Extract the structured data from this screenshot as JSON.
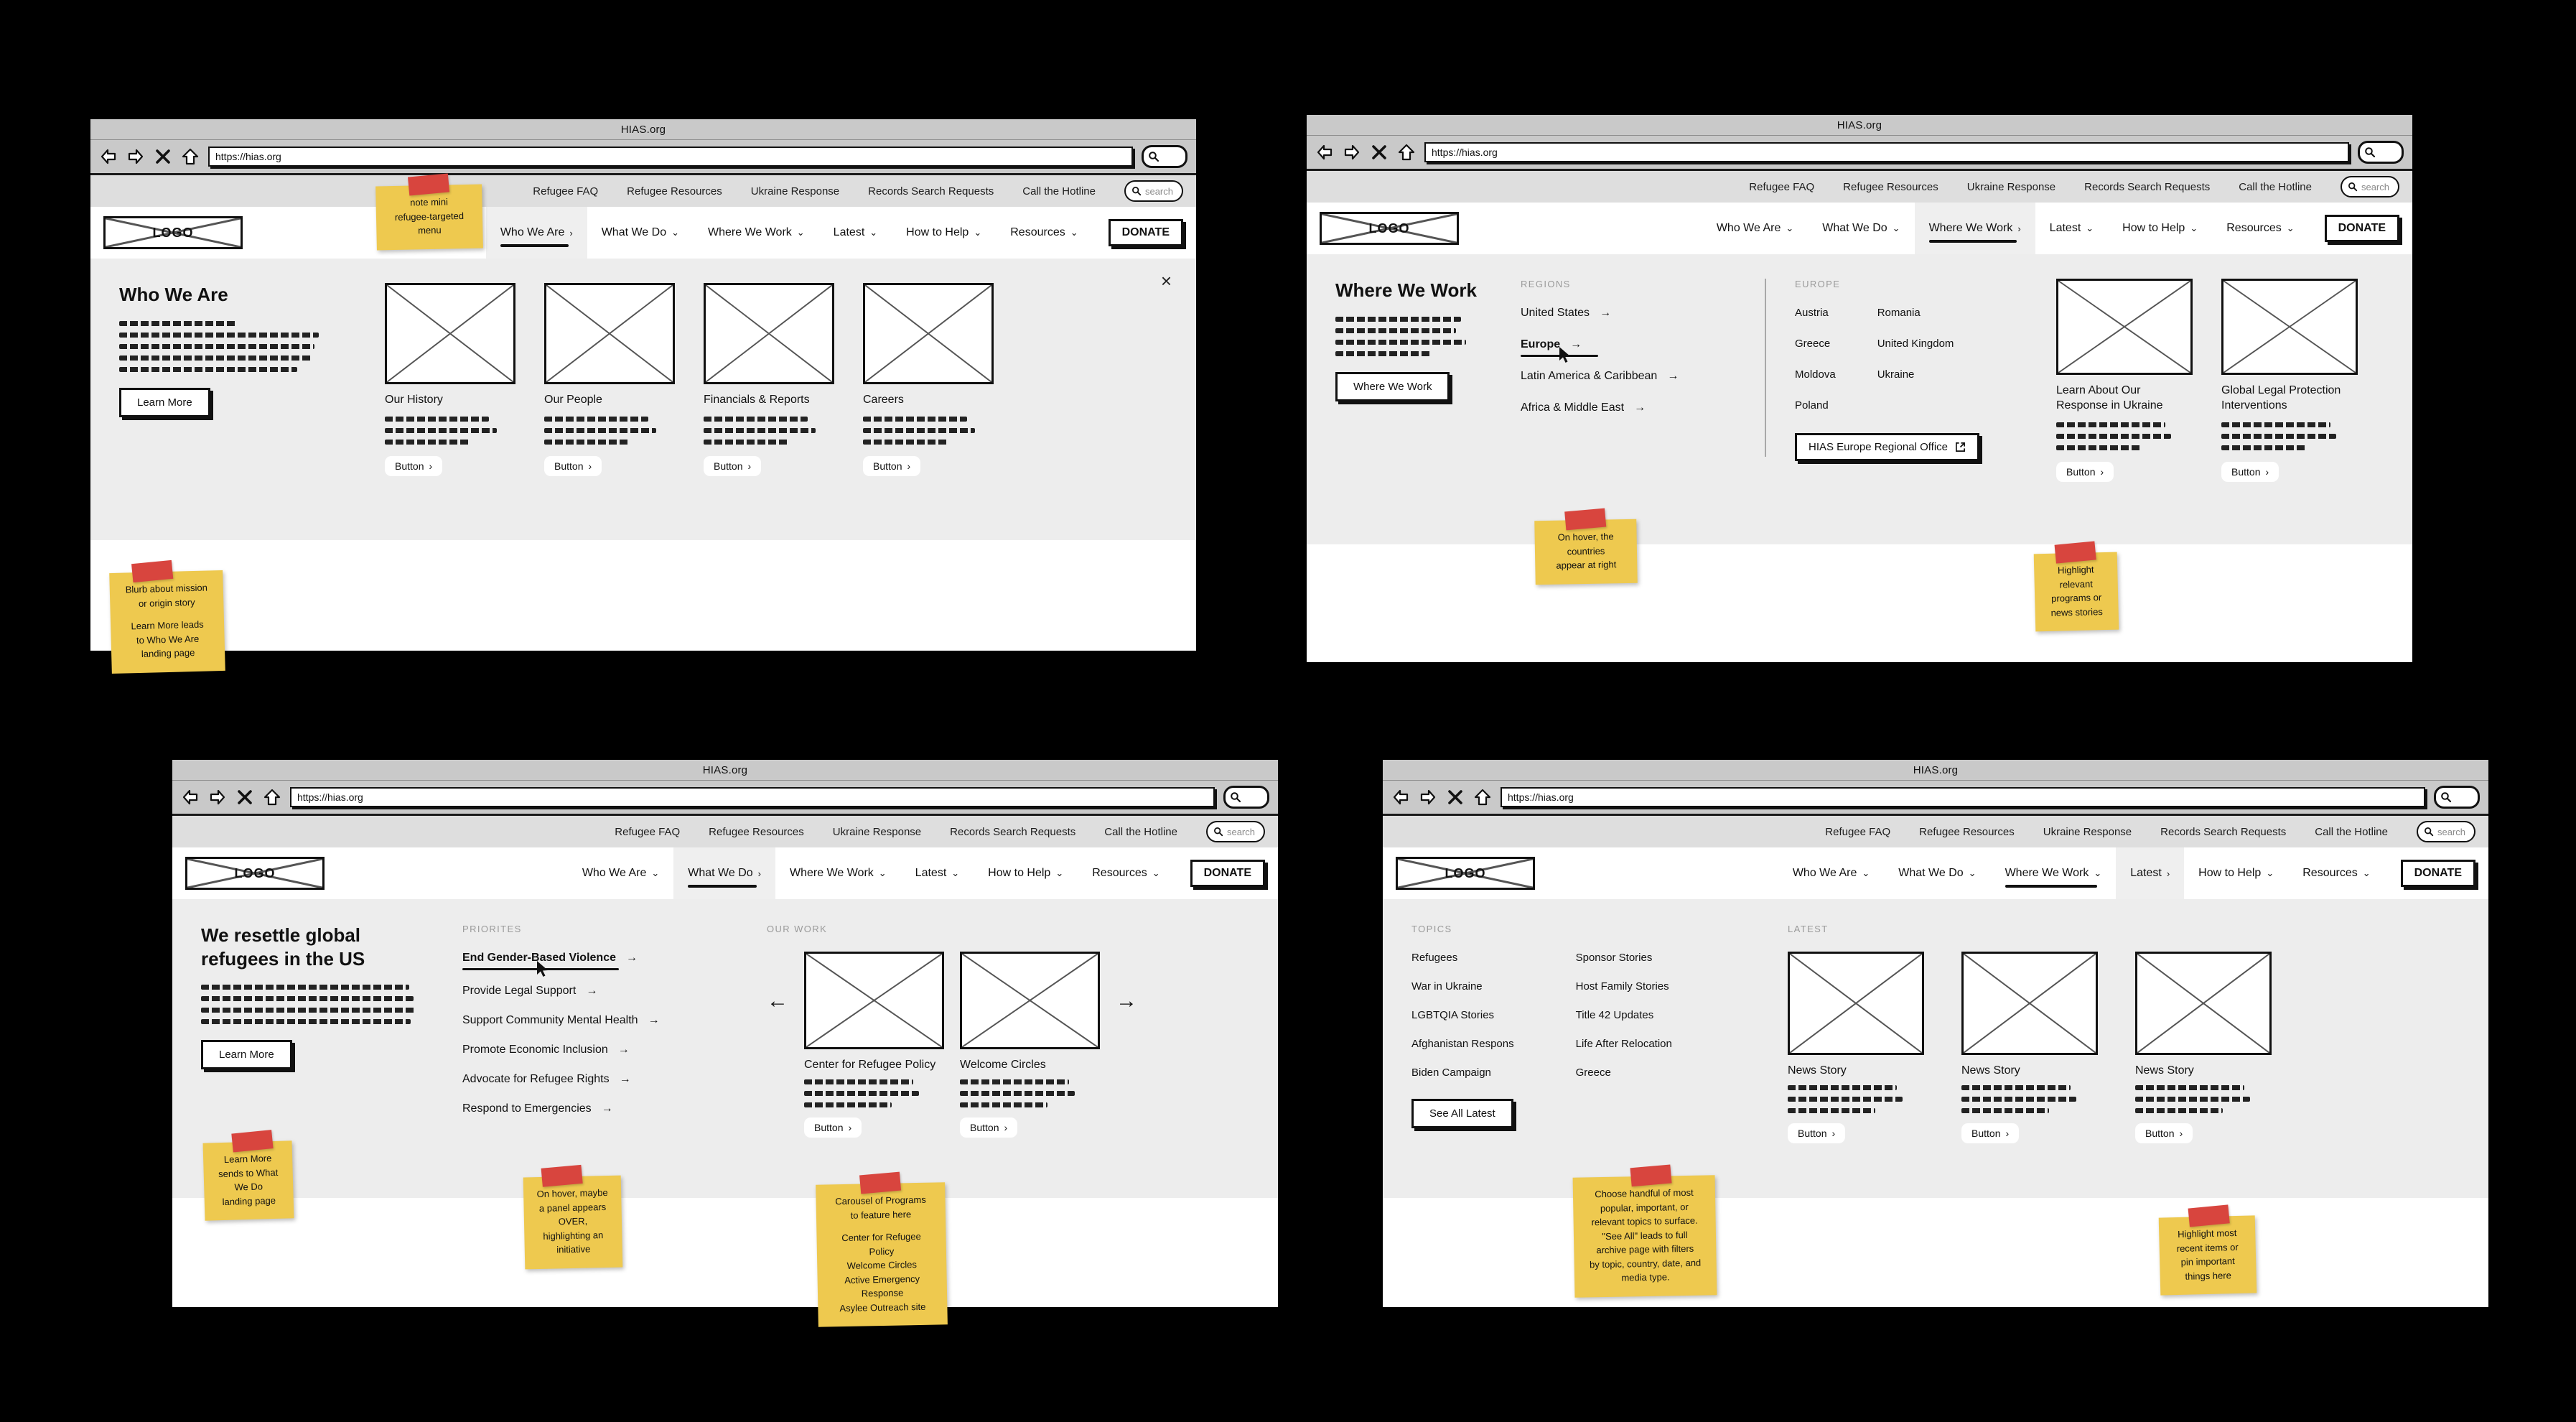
{
  "browser": {
    "title": "HIAS.org",
    "url": "https://hias.org",
    "back_icon": "back-arrow-icon",
    "forward_icon": "forward-arrow-icon",
    "stop_icon": "close-x-icon",
    "home_icon": "home-icon",
    "search_icon": "search-icon"
  },
  "utility_nav": {
    "items": [
      "Refugee FAQ",
      "Refugee Resources",
      "Ukraine Response",
      "Records Search Requests",
      "Call the Hotline"
    ],
    "search_placeholder": "search"
  },
  "brand": {
    "logo_label": "LOGO"
  },
  "main_nav": {
    "items": [
      "Who We Are",
      "What We Do",
      "Where We Work",
      "Latest",
      "How to Help",
      "Resources"
    ],
    "donate_label": "DONATE",
    "chevron_down": "⌄",
    "chevron_right": "›"
  },
  "panel1": {
    "active_tab": "Who We Are",
    "heading": "Who We Are",
    "cta": "Learn More",
    "close_label": "×",
    "cards": [
      {
        "title": "Our History",
        "button": "Button"
      },
      {
        "title": "Our People",
        "button": "Button"
      },
      {
        "title": "Financials & Reports",
        "button": "Button"
      },
      {
        "title": "Careers",
        "button": "Button"
      }
    ],
    "notes": [
      {
        "lines": [
          "note mini",
          "refugee-targeted",
          "menu"
        ]
      },
      {
        "lines": [
          "Blurb about mission",
          "or origin story"
        ],
        "lines2": [
          "Learn More leads",
          "to Who We Are",
          "landing page"
        ]
      }
    ]
  },
  "panel2": {
    "active_tab": "Where We Work",
    "heading": "Where We Work",
    "cta": "Where We Work",
    "regions_label": "REGIONS",
    "regions": [
      "United States",
      "Europe",
      "Latin America & Caribbean",
      "Africa & Middle East"
    ],
    "hovered_region": "Europe",
    "europe_label": "EUROPE",
    "countries_col1": [
      "Austria",
      "Greece",
      "Moldova",
      "Poland"
    ],
    "countries_col2": [
      "Romania",
      "United Kingdom",
      "Ukraine"
    ],
    "office_button": "HIAS Europe Regional Office",
    "office_icon": "external-link-icon",
    "cards": [
      {
        "title": "Learn About Our Response in Ukraine",
        "button": "Button"
      },
      {
        "title": "Global Legal Protection Interventions",
        "button": "Button"
      }
    ],
    "notes": [
      {
        "lines": [
          "On hover, the",
          "countries",
          "appear at right"
        ]
      },
      {
        "lines": [
          "Highlight",
          "relevant",
          "programs or",
          "news stories"
        ]
      }
    ]
  },
  "panel3": {
    "active_tab": "What We Do",
    "underline_tab": "What We Do",
    "heading": "We resettle global refugees in the US",
    "cta": "Learn More",
    "priorities_label": "PRIORITES",
    "priorities": [
      "End Gender-Based Violence",
      "Provide Legal Support",
      "Support Community Mental Health",
      "Promote Economic Inclusion",
      "Advocate for Refugee Rights",
      "Respond to Emergencies"
    ],
    "hovered_priority": "End Gender-Based Violence",
    "our_work_label": "OUR WORK",
    "cards": [
      {
        "title": "Center for Refugee Policy",
        "button": "Button"
      },
      {
        "title": "Welcome Circles",
        "button": "Button"
      }
    ],
    "prev_icon": "arrow-left-icon",
    "next_icon": "arrow-right-icon",
    "notes": [
      {
        "lines": [
          "Learn More",
          "sends to What",
          "We Do",
          "landing page"
        ]
      },
      {
        "lines": [
          "On hover, maybe",
          "a panel appears",
          "OVER,",
          "highlighting an",
          "initiative"
        ]
      },
      {
        "lines": [
          "Carousel of Programs",
          "to feature here"
        ],
        "lines2": [
          "Center for Refugee",
          "Policy",
          "Welcome Circles",
          "Active Emergency",
          "Response",
          "Asylee Outreach site"
        ]
      }
    ]
  },
  "panel4": {
    "active_tab": "Latest",
    "underline_tab": "Where We Work",
    "topics_label": "TOPICS",
    "topics_col1": [
      "Refugees",
      "War in Ukraine",
      "LGBTQIA Stories",
      "Afghanistan Respons",
      "Biden Campaign"
    ],
    "topics_col2": [
      "Sponsor Stories",
      "Host Family Stories",
      "Title 42 Updates",
      "Life After Relocation",
      "Greece"
    ],
    "see_all": "See All Latest",
    "latest_label": "LATEST",
    "cards": [
      {
        "title": "News Story",
        "button": "Button"
      },
      {
        "title": "News Story",
        "button": "Button"
      },
      {
        "title": "News Story",
        "button": "Button"
      }
    ],
    "notes": [
      {
        "lines": [
          "Choose handful of most",
          "popular, important, or",
          "relevant topics to surface.",
          "\"See All\" leads to full",
          "archive page with filters",
          "by topic, country, date, and",
          "media type."
        ]
      },
      {
        "lines": [
          "Highlight most",
          "recent items or",
          "pin important",
          "things here"
        ]
      }
    ]
  },
  "colors": {
    "note_yellow": "#eec94f",
    "tape_red": "#d8453e",
    "panel_gray": "#ededed",
    "chrome_gray": "#c9c9c9",
    "utility_gray": "#dedede"
  }
}
